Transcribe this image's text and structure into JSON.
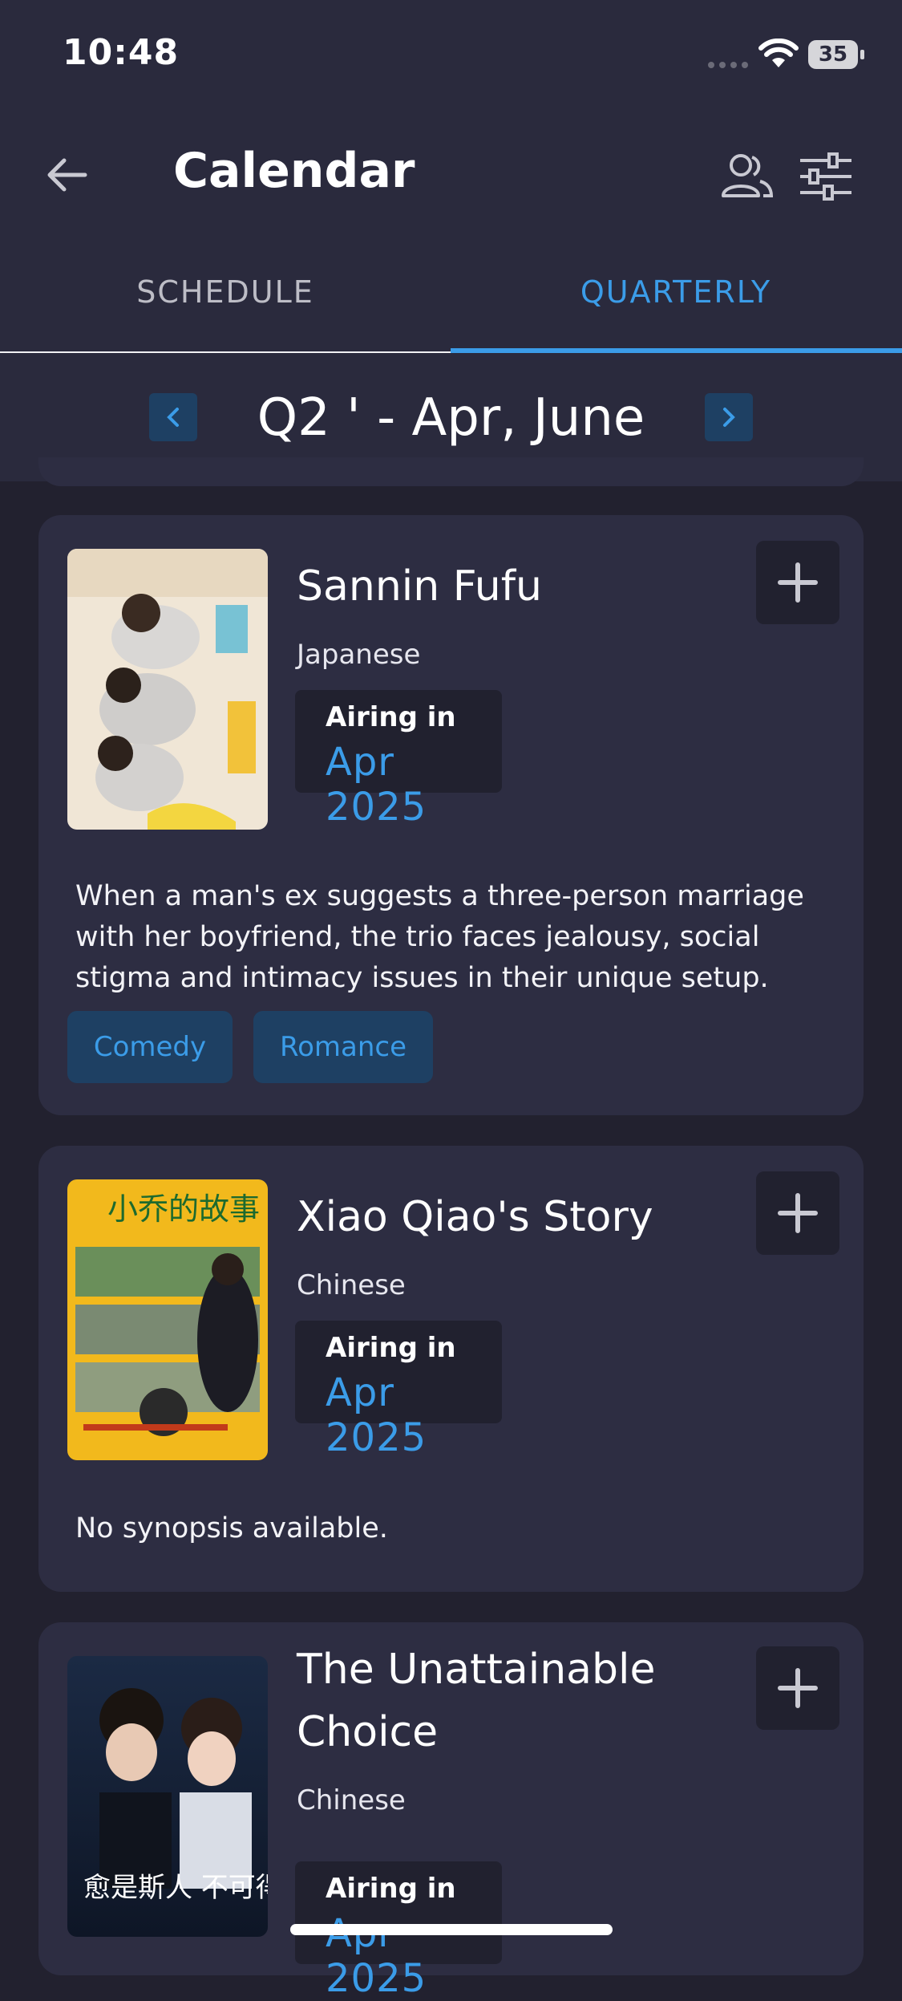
{
  "status_bar": {
    "time": "10:48",
    "battery": "35"
  },
  "app_bar": {
    "title": "Calendar"
  },
  "tabs": [
    {
      "label": "SCHEDULE",
      "active": false
    },
    {
      "label": "QUARTERLY",
      "active": true
    }
  ],
  "quarter_nav": {
    "title": "Q2 ' - Apr, June"
  },
  "shows": [
    {
      "title": "Sannin Fufu",
      "language": "Japanese",
      "airing_label": "Airing in",
      "airing_date": "Apr 2025",
      "synopsis": "When a man's ex suggests a three-person marriage with her boyfriend, the trio faces jealousy, social stigma and intimacy issues in their unique setup.",
      "genres": [
        "Comedy",
        "Romance"
      ]
    },
    {
      "title": "Xiao Qiao's Story",
      "language": "Chinese",
      "airing_label": "Airing in",
      "airing_date": "Apr 2025",
      "synopsis": "No synopsis available.",
      "genres": [],
      "poster_text": "小乔的故事"
    },
    {
      "title": "The Unattainable Choice",
      "language": "Chinese",
      "airing_label": "Airing in",
      "airing_date": "Apr 2025",
      "poster_text": "愈是斯人 不可得"
    }
  ],
  "colors": {
    "accent": "#3b9ce8",
    "background": "#22212f",
    "surface": "#2a2a3d",
    "card": "#2d2d42",
    "chip": "#1e4063"
  },
  "icons": [
    "back-arrow-icon",
    "people-icon",
    "filter-sliders-icon",
    "chevron-left-icon",
    "chevron-right-icon",
    "plus-icon",
    "wifi-icon",
    "signal-icon"
  ]
}
